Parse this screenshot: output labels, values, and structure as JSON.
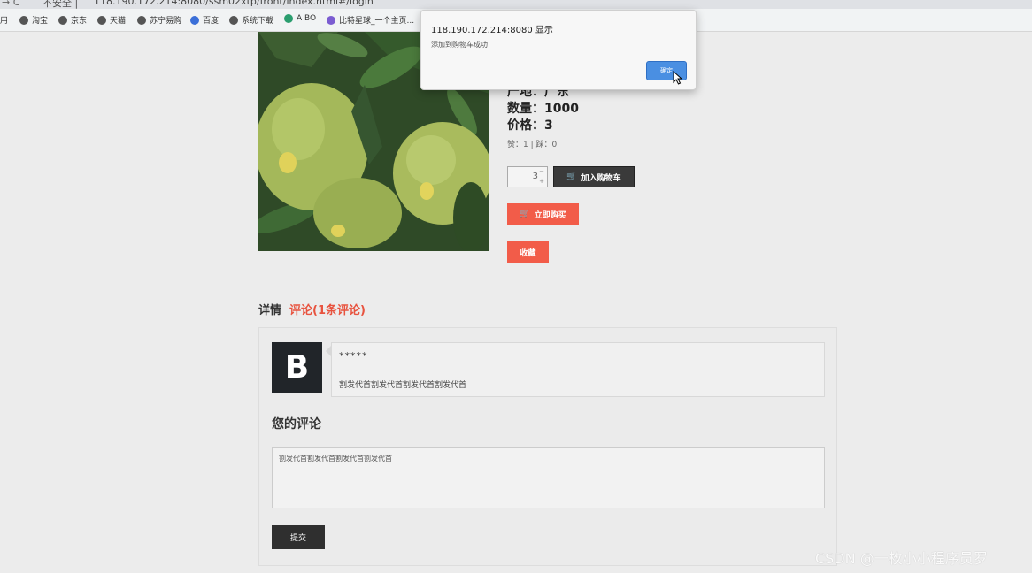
{
  "browser": {
    "nav_glyph": "→  C",
    "security_label": "不安全 |",
    "url": "118.190.172.214:8080/ssm02xtp/front/index.html#/login",
    "bookmarks": [
      {
        "label": "用"
      },
      {
        "label": "淘宝"
      },
      {
        "label": "京东"
      },
      {
        "label": "天猫"
      },
      {
        "label": "苏宁易购"
      },
      {
        "label": "百度"
      },
      {
        "label": "系统下载"
      },
      {
        "label": "A BO"
      },
      {
        "label": "比特星球_一个主页..."
      }
    ]
  },
  "product": {
    "origin_line": "产地：广东",
    "quantity_line": "数量：1000",
    "price_line": "价格：3",
    "votes_line": "赞：1 | 踩：0",
    "qty_value": "3",
    "add_to_cart_label": "加入购物车",
    "buy_now_label": "立即购买",
    "favorite_label": "收藏"
  },
  "tabs": {
    "detail_label": "详情",
    "comments_label": "评论(1条评论)"
  },
  "comments": [
    {
      "avatar_letter": "B",
      "user": "*****",
      "text": "割发代首割发代首割发代首割发代首"
    }
  ],
  "your_comment": {
    "title": "您的评论",
    "textarea_value": "割发代首割发代首割发代首割发代首",
    "submit_label": "提交"
  },
  "dialog": {
    "title": "118.190.172.214:8080 显示",
    "message": "添加到购物车成功",
    "ok_label": "确定"
  },
  "watermark": "CSDN @一枚小小程序员罗",
  "colors": {
    "accent_red": "#f25c49",
    "tab_active": "#e8533f",
    "dialog_button": "#4a8fe2"
  }
}
